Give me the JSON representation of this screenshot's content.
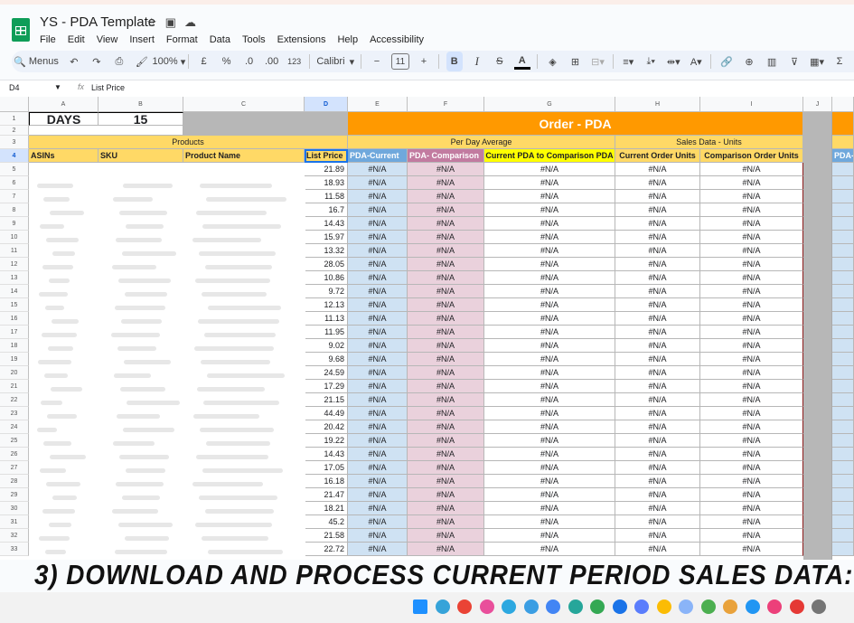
{
  "app": {
    "title": "YS - PDA Template",
    "menu": [
      "File",
      "Edit",
      "View",
      "Insert",
      "Format",
      "Data",
      "Tools",
      "Extensions",
      "Help",
      "Accessibility"
    ]
  },
  "toolbar": {
    "search_label": "Menus",
    "zoom": "100%",
    "currency": "£",
    "percent": "%",
    "dec_decrease": ".0",
    "dec_increase": ".00",
    "number_format": "123",
    "font": "Calibri",
    "font_size": "11",
    "bold": "B",
    "italic": "I",
    "strike": "S",
    "text_color": "A"
  },
  "formula_bar": {
    "cell_ref": "D4",
    "fx": "fx",
    "value": "List Price"
  },
  "sheet": {
    "columns": [
      "A",
      "B",
      "C",
      "D",
      "E",
      "F",
      "G",
      "H",
      "I",
      "J"
    ],
    "days_label": "DAYS",
    "days_value": "15",
    "order_pda_title": "Order - PDA",
    "products_header": "Products",
    "per_day_header": "Per Day Average",
    "sales_header": "Sales Data - Units",
    "col_asins": "ASINs",
    "col_sku": "SKU",
    "col_product_name": "Product Name",
    "col_list_price": "List Price",
    "col_pda_current": "PDA-Current",
    "col_pda_comparison": "PDA- Comparison",
    "col_current_vs_comparison": "Current PDA to Comparison PDA",
    "col_current_units": "Current Order Units",
    "col_comparison_units": "Comparison Order Units",
    "col_k_partial": "PDA-",
    "error_value": "#N/A",
    "row_numbers": [
      "1",
      "2",
      "3",
      "4",
      "5",
      "6",
      "7",
      "8",
      "9",
      "10",
      "11",
      "12",
      "13",
      "14",
      "15",
      "16",
      "17",
      "18",
      "19",
      "20",
      "21",
      "22",
      "23",
      "24",
      "25",
      "26",
      "27",
      "28",
      "29",
      "30",
      "31",
      "32",
      "33"
    ],
    "list_prices": [
      "21.89",
      "18.93",
      "11.58",
      "16.7",
      "14.43",
      "15.97",
      "13.32",
      "28.05",
      "10.86",
      "9.72",
      "12.13",
      "11.13",
      "11.95",
      "9.02",
      "9.68",
      "24.59",
      "17.29",
      "21.15",
      "44.49",
      "20.42",
      "19.22",
      "14.43",
      "17.05",
      "16.18",
      "21.47",
      "18.21",
      "45.2",
      "21.58",
      "22.72"
    ]
  },
  "caption": "3) DOWNLOAD AND PROCESS CURRENT PERIOD SALES DATA:",
  "colors": {
    "orange": "#ff9900",
    "light_orange": "#ffd966",
    "header_blue": "#6fa8dc",
    "cell_blue": "#cfe2f3",
    "header_pink": "#c27ba0",
    "cell_pink": "#ead1dc",
    "yellow": "#ffff00",
    "gray_band": "#b7b7b7"
  }
}
